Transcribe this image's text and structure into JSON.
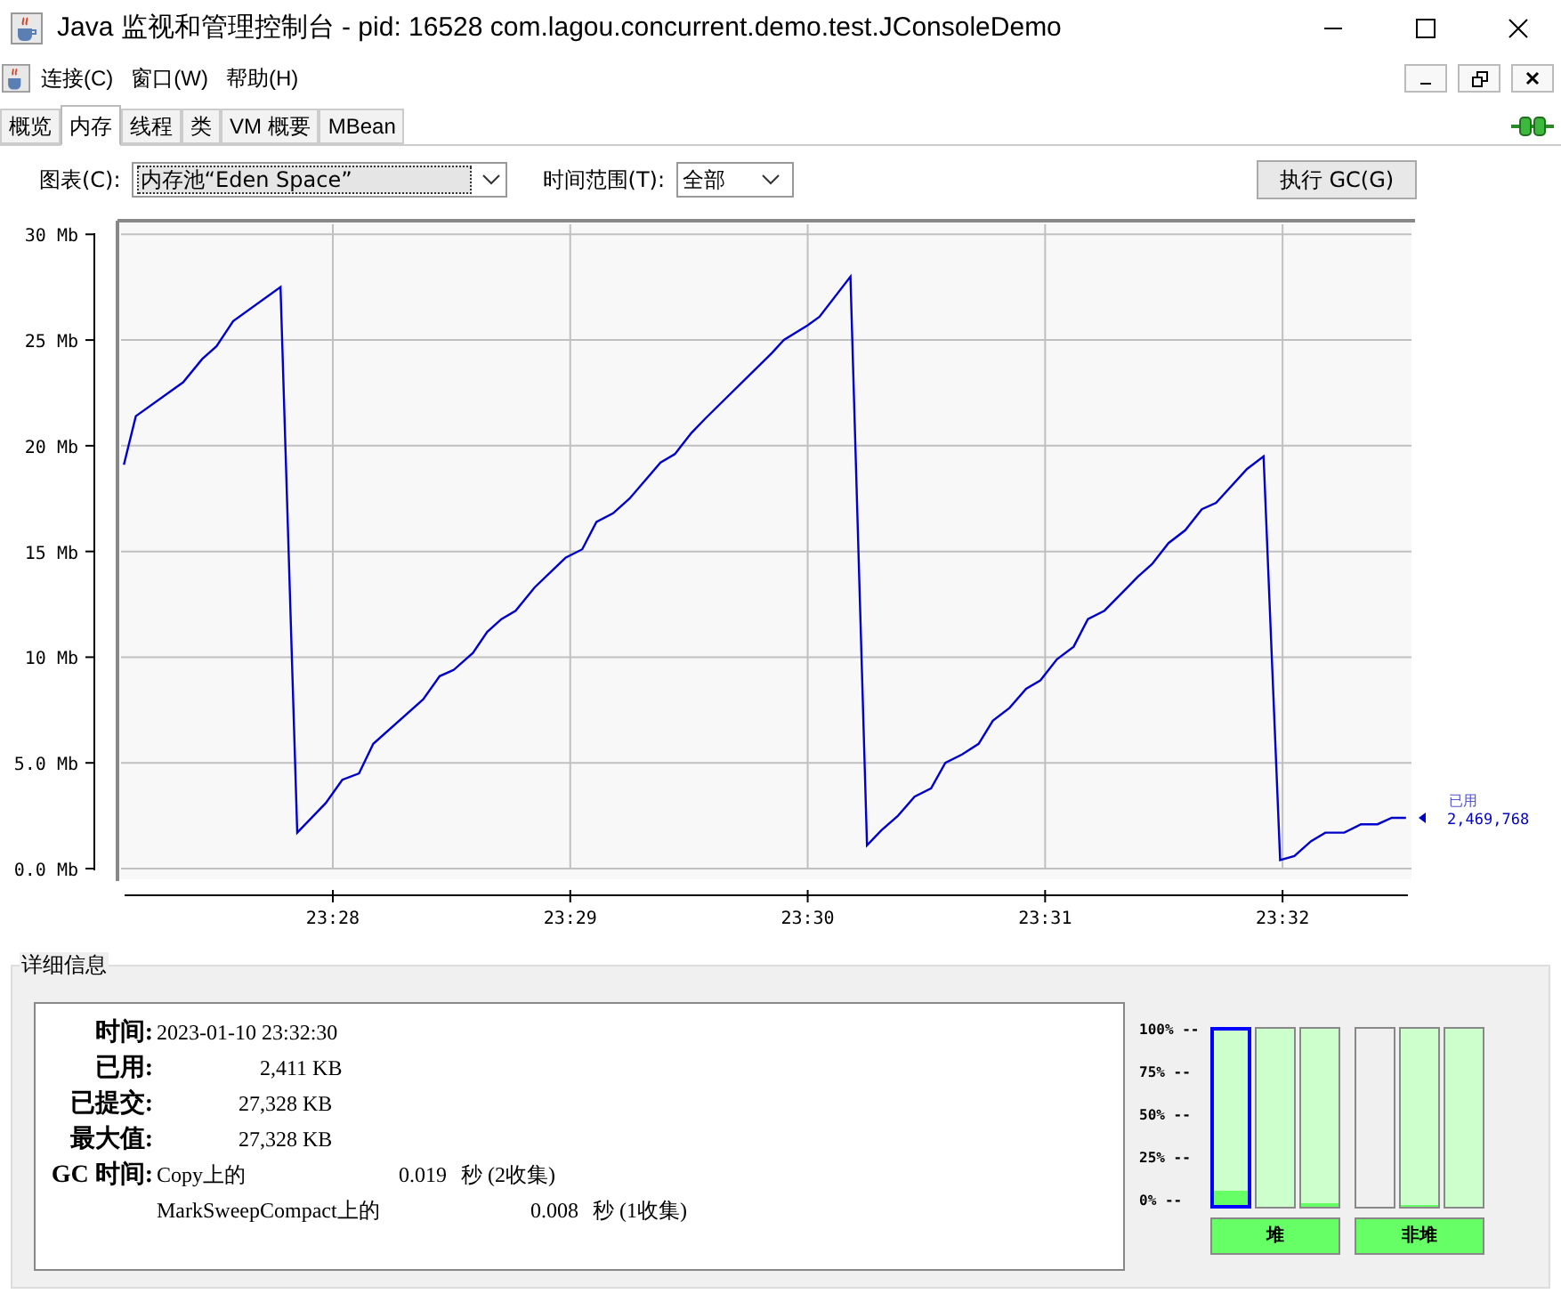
{
  "window": {
    "title": "Java 监视和管理控制台 - pid: 16528 com.lagou.concurrent.demo.test.JConsoleDemo"
  },
  "menu": [
    "连接(C)",
    "窗口(W)",
    "帮助(H)"
  ],
  "tabs": [
    {
      "label": "概览",
      "selected": false
    },
    {
      "label": "内存",
      "selected": true
    },
    {
      "label": "线程",
      "selected": false
    },
    {
      "label": "类",
      "selected": false
    },
    {
      "label": "VM 概要",
      "selected": false
    },
    {
      "label": "MBean",
      "selected": false
    }
  ],
  "chart_selector": {
    "label": "图表(C):",
    "value": "内存池“Eden Space”"
  },
  "time_range": {
    "label": "时间范围(T):",
    "value": "全部"
  },
  "gc_button": "执行 GC(G)",
  "memory_chart": {
    "legend_value": "2,469,768",
    "chart_data": {
      "type": "line",
      "grid": true,
      "xlim": [
        1407.108,
        1412.543
      ],
      "ylim": [
        0,
        30.56
      ],
      "xticks": [
        {
          "value": 1408,
          "label": "23:28"
        },
        {
          "value": 1409,
          "label": "23:29"
        },
        {
          "value": 1410,
          "label": "23:30"
        },
        {
          "value": 1411,
          "label": "23:31"
        },
        {
          "value": 1412,
          "label": "23:32"
        }
      ],
      "yticks": [
        {
          "value": 0,
          "label": "0.0 Mb"
        },
        {
          "value": 5,
          "label": "5.0 Mb"
        },
        {
          "value": 10,
          "label": "10 Mb"
        },
        {
          "value": 15,
          "label": "15 Mb"
        },
        {
          "value": 20,
          "label": "20 Mb"
        },
        {
          "value": 25,
          "label": "25 Mb"
        },
        {
          "value": 30,
          "label": "30 Mb"
        }
      ],
      "x": [
        1407.12,
        1407.17,
        1407.37,
        1407.45,
        1407.51,
        1407.58,
        1407.78,
        1407.85,
        1407.97,
        1408.04,
        1408.11,
        1408.17,
        1408.38,
        1408.45,
        1408.51,
        1408.59,
        1408.65,
        1408.71,
        1408.77,
        1408.85,
        1408.98,
        1409.05,
        1409.11,
        1409.18,
        1409.25,
        1409.38,
        1409.44,
        1409.51,
        1409.57,
        1409.85,
        1409.9,
        1410,
        1410.05,
        1410.18,
        1410.25,
        1410.31,
        1410.38,
        1410.45,
        1410.52,
        1410.58,
        1410.65,
        1410.72,
        1410.78,
        1410.85,
        1410.92,
        1410.98,
        1411.05,
        1411.12,
        1411.18,
        1411.25,
        1411.39,
        1411.45,
        1411.52,
        1411.59,
        1411.66,
        1411.72,
        1411.85,
        1411.92,
        1411.99,
        1412.05,
        1412.12,
        1412.18,
        1412.26,
        1412.33,
        1412.4,
        1412.46,
        1412.52
      ],
      "series": [
        {
          "name": "已用",
          "color": "#0000cc",
          "values": [
            19.1,
            21.4,
            23.0,
            24.1,
            24.7,
            25.9,
            27.5,
            1.7,
            3.1,
            4.2,
            4.5,
            5.9,
            8.0,
            9.1,
            9.4,
            10.2,
            11.2,
            11.8,
            12.2,
            13.3,
            14.7,
            15.1,
            16.4,
            16.8,
            17.5,
            19.2,
            19.6,
            20.6,
            21.3,
            24.4,
            25.0,
            25.7,
            26.1,
            28.0,
            1.1,
            1.8,
            2.5,
            3.4,
            3.8,
            5.0,
            5.4,
            5.9,
            7.0,
            7.6,
            8.5,
            8.9,
            9.9,
            10.5,
            11.8,
            12.2,
            13.8,
            14.4,
            15.4,
            16.0,
            17.0,
            17.3,
            18.9,
            19.5,
            0.4,
            0.6,
            1.3,
            1.7,
            1.7,
            2.1,
            2.1,
            2.4,
            2.4
          ]
        }
      ]
    }
  },
  "details": {
    "title": "详细信息",
    "fields": [
      {
        "label": "时间:",
        "value": "2023-01-10 23:32:30"
      },
      {
        "label": "已用:",
        "value": "2,411 KB"
      },
      {
        "label": "已提交:",
        "value": "27,328 KB"
      },
      {
        "label": "最大值:",
        "value": "27,328 KB"
      }
    ],
    "gc_label": "GC 时间:",
    "gc_rows": [
      {
        "collector": "Copy上的",
        "time": "0.019",
        "unit": "秒 (2收集)"
      },
      {
        "collector": "MarkSweepCompact上的",
        "time": "0.008",
        "unit": "秒 (1收集)"
      }
    ]
  },
  "memory_pools": {
    "ticks": [
      "100% --",
      "75% --",
      "50% --",
      "25% --",
      "0% --"
    ],
    "bars": [
      {
        "kind": "pool",
        "level": 0.08,
        "selected": true
      },
      {
        "kind": "pool",
        "selected": false
      },
      {
        "kind": "pool",
        "level": 0.02,
        "selected": false
      },
      {
        "kind": "unused",
        "selected": false
      },
      {
        "kind": "pool",
        "level": 0.01,
        "selected": false
      },
      {
        "kind": "pool",
        "selected": false
      }
    ],
    "groups": [
      "堆",
      "非堆"
    ]
  }
}
